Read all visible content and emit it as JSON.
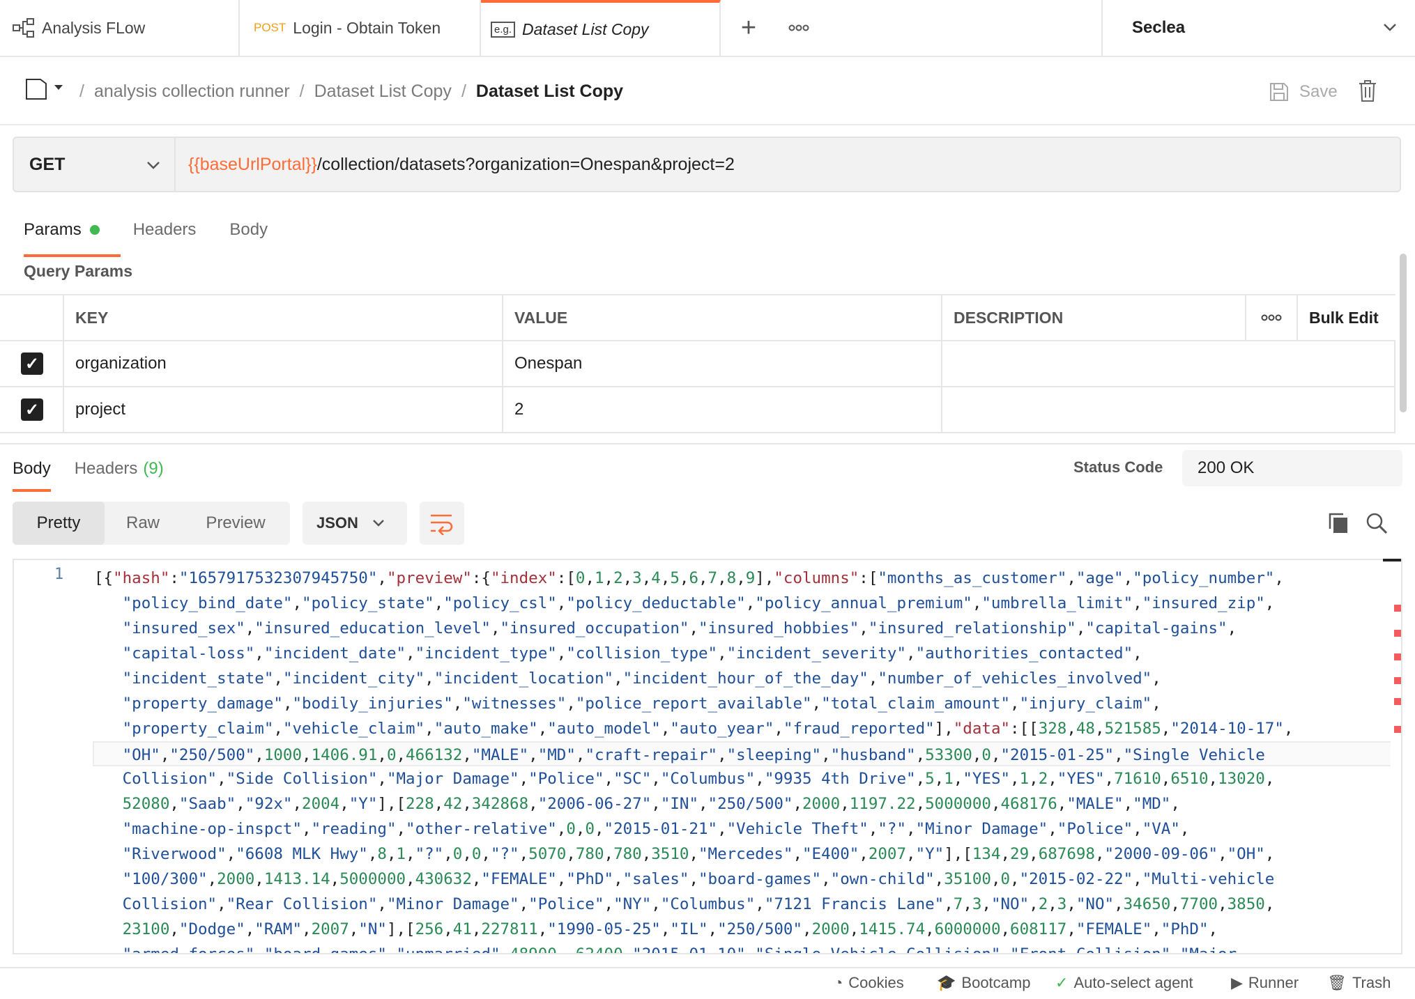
{
  "tabs": [
    {
      "label": "Analysis FLow",
      "icon": "flow-icon"
    },
    {
      "method": "POST",
      "label": "Login - Obtain Token"
    },
    {
      "badge": "e.g.",
      "label": "Dataset List Copy"
    }
  ],
  "workspace": {
    "name": "Seclea"
  },
  "breadcrumb": {
    "items": [
      "analysis collection runner",
      "Dataset List Copy"
    ],
    "current": "Dataset List Copy",
    "separator": "/"
  },
  "actions": {
    "save_label": "Save"
  },
  "request": {
    "method": "GET",
    "url_variable": "{{baseUrlPortal}}",
    "url_path": "/collection/datasets?organization=Onespan&project=2"
  },
  "request_tabs": [
    "Params",
    "Headers",
    "Body"
  ],
  "params": {
    "title": "Query Params",
    "columns": [
      "KEY",
      "VALUE",
      "DESCRIPTION"
    ],
    "bulk_edit_label": "Bulk Edit",
    "rows": [
      {
        "checked": true,
        "key": "organization",
        "value": "Onespan",
        "description": ""
      },
      {
        "checked": true,
        "key": "project",
        "value": "2",
        "description": ""
      }
    ]
  },
  "response": {
    "tabs": [
      "Body",
      "Headers"
    ],
    "headers_count": "(9)",
    "status_label": "Status Code",
    "status_value": "200 OK",
    "view_modes": [
      "Pretty",
      "Raw",
      "Preview"
    ],
    "active_view": "Pretty",
    "format": "JSON",
    "line_number": "1"
  },
  "footer": [
    {
      "label": "Cookies",
      "icon": "cookie-icon"
    },
    {
      "label": "Bootcamp",
      "icon": "bootcamp-icon"
    },
    {
      "label": "Auto-select agent",
      "icon": "check-circle-icon"
    },
    {
      "label": "Runner",
      "icon": "runner-icon"
    },
    {
      "label": "Trash",
      "icon": "trash-icon"
    }
  ],
  "colors": {
    "accent": "#ff6c37",
    "success": "#3fb950"
  }
}
